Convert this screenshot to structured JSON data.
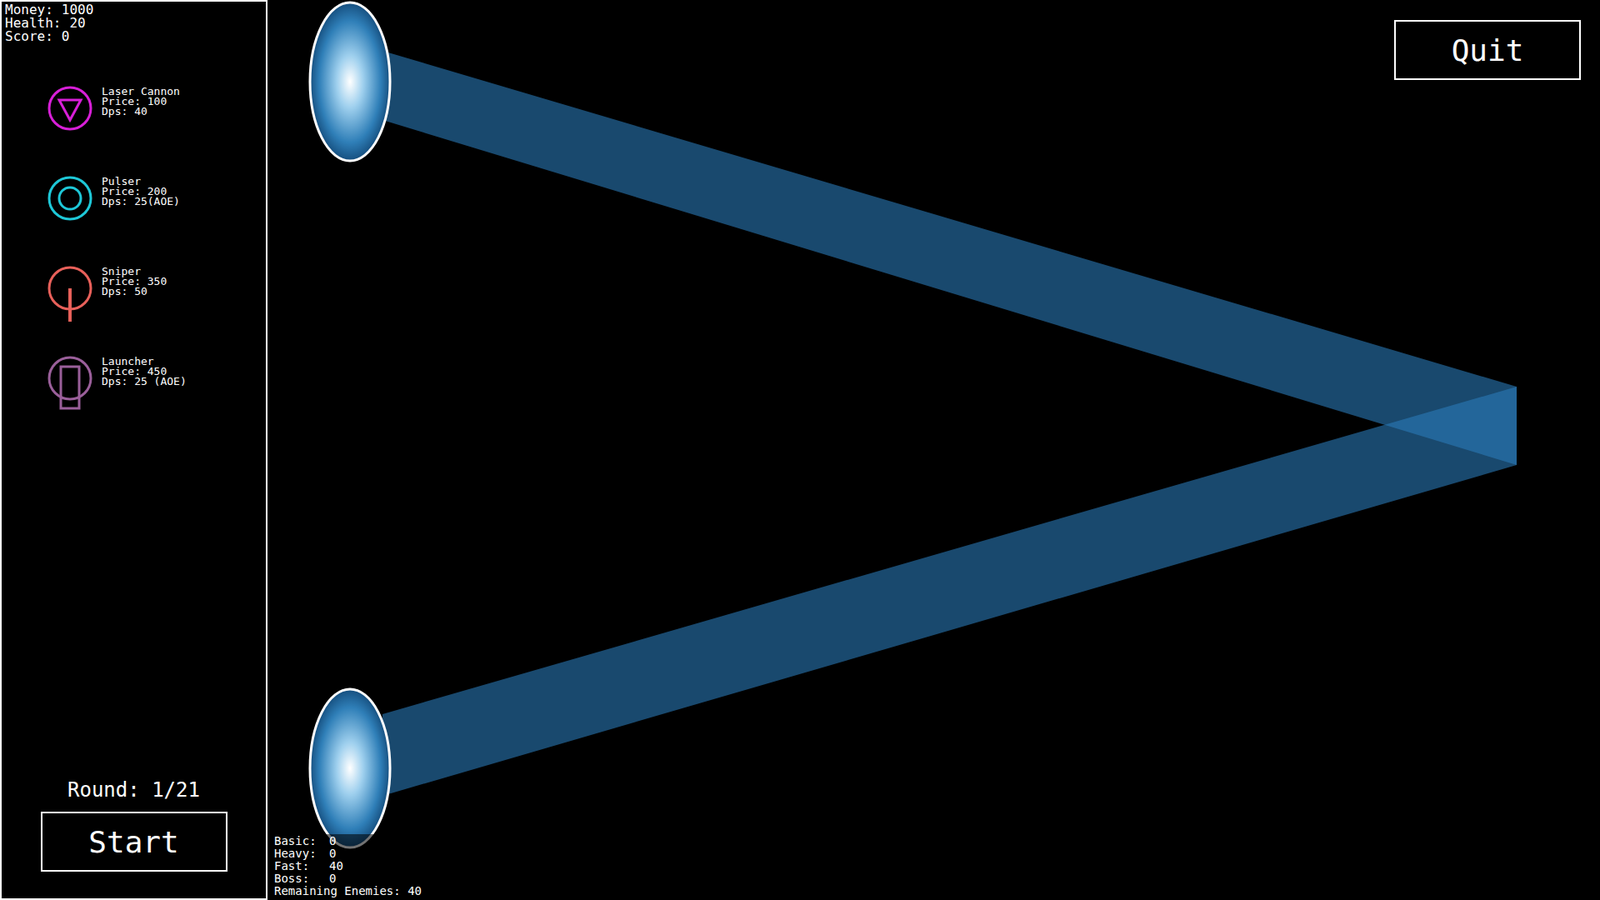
{
  "stats": [
    {
      "label": "Money:",
      "value": "1000"
    },
    {
      "label": "Health:",
      "value": "20"
    },
    {
      "label": "Score:",
      "value": "0"
    }
  ],
  "towers": [
    {
      "name": "Laser Cannon",
      "price": "Price: 100",
      "dps": "Dps: 40",
      "color": "#d81fd8",
      "kind": "triangle"
    },
    {
      "name": "Pulser",
      "price": "Price: 200",
      "dps": "Dps: 25(AOE)",
      "color": "#1ec8d8",
      "kind": "ring"
    },
    {
      "name": "Sniper",
      "price": "Price: 350",
      "dps": "Dps: 50",
      "color": "#e8605a",
      "kind": "sniper"
    },
    {
      "name": "Launcher",
      "price": "Price: 450",
      "dps": "Dps: 25 (AOE)",
      "color": "#9a5f9a",
      "kind": "launcher"
    }
  ],
  "round": "Round: 1/21",
  "start_button": "Start",
  "quit_button": "Quit",
  "enemies": [
    {
      "label": "Basic:",
      "value": "0"
    },
    {
      "label": "Heavy:",
      "value": "0"
    },
    {
      "label": "Fast:",
      "value": "40"
    },
    {
      "label": "Boss:",
      "value": "0"
    }
  ],
  "remaining": "Remaining Enemies: 40"
}
